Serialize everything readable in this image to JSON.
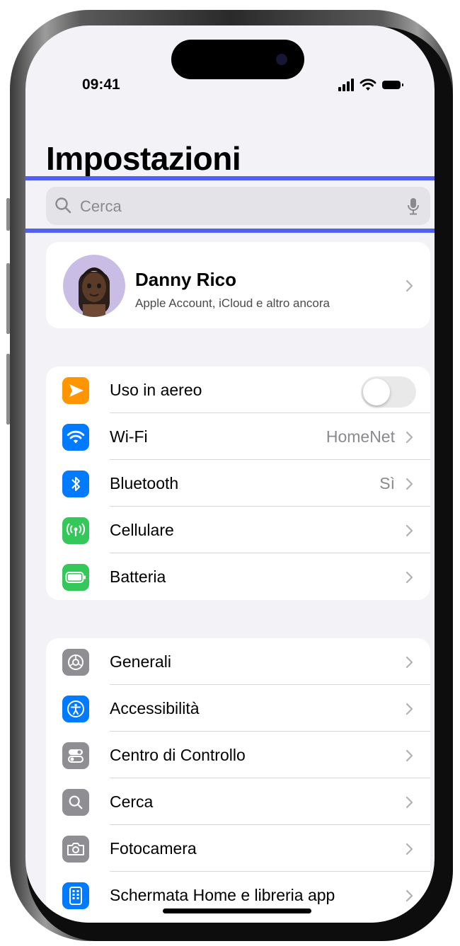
{
  "status_bar": {
    "time": "09:41"
  },
  "page": {
    "title": "Impostazioni"
  },
  "search": {
    "placeholder": "Cerca"
  },
  "profile": {
    "name": "Danny Rico",
    "subtitle": "Apple Account, iCloud e altro ancora"
  },
  "connectivity": {
    "items": [
      {
        "label": "Uso in aereo",
        "icon": "airplane-icon",
        "color": "#ff9500",
        "toggle_on": false
      },
      {
        "label": "Wi-Fi",
        "value": "HomeNet",
        "icon": "wifi-icon",
        "color": "#007aff"
      },
      {
        "label": "Bluetooth",
        "value": "Sì",
        "icon": "bluetooth-icon",
        "color": "#007aff"
      },
      {
        "label": "Cellulare",
        "icon": "cellular-antenna-icon",
        "color": "#34c759"
      },
      {
        "label": "Batteria",
        "icon": "battery-icon",
        "color": "#34c759"
      }
    ]
  },
  "general": {
    "items": [
      {
        "label": "Generali",
        "icon": "gear-icon",
        "color": "#8e8e93"
      },
      {
        "label": "Accessibilità",
        "icon": "accessibility-icon",
        "color": "#007aff"
      },
      {
        "label": "Centro di Controllo",
        "icon": "control-center-icon",
        "color": "#8e8e93"
      },
      {
        "label": "Cerca",
        "icon": "search-icon",
        "color": "#8e8e93"
      },
      {
        "label": "Fotocamera",
        "icon": "camera-icon",
        "color": "#8e8e93"
      },
      {
        "label": "Schermata Home e libreria app",
        "icon": "home-screen-icon",
        "color": "#007aff"
      }
    ]
  }
}
